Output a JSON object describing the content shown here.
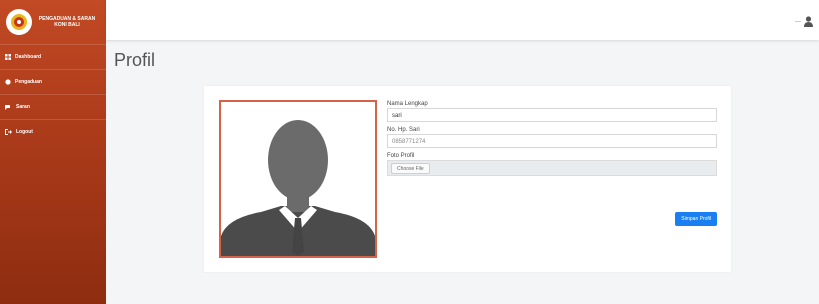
{
  "sidebar": {
    "brand": "PENGADUAN & SARAN KONI BALI",
    "items": [
      {
        "icon": "dashboard-icon",
        "label": "Dashboard"
      },
      {
        "icon": "pengaduan-icon",
        "label": "Pengaduan"
      },
      {
        "icon": "saran-icon",
        "label": "Saran"
      },
      {
        "icon": "logout-icon",
        "label": "Logout"
      }
    ]
  },
  "topbar": {
    "user_name": "—",
    "user_icon": "user-icon"
  },
  "page": {
    "title": "Profil"
  },
  "profile": {
    "name_label": "Nama Lengkap",
    "name_value": "sari",
    "phone_label": "No. Hp. Sari",
    "phone_value": "0858771274",
    "photo_label": "Foto Profil",
    "file_button": "Choose File",
    "save_button": "Simpan Profil"
  },
  "colors": {
    "sidebar": "#b03d1c",
    "accent": "#1a7ff0",
    "photo_border": "#d5634a"
  }
}
